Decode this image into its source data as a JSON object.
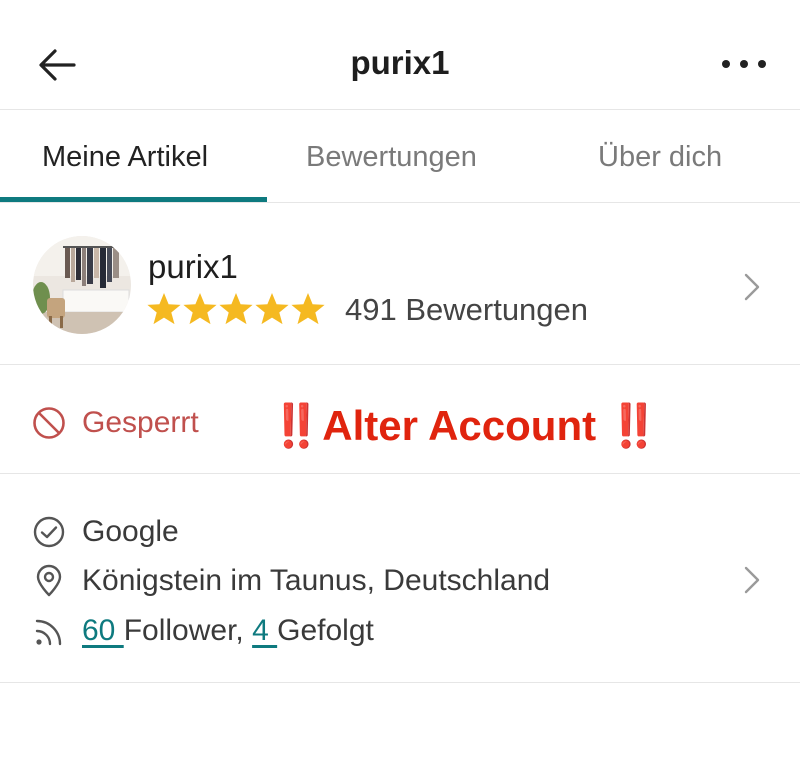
{
  "header": {
    "title": "purix1",
    "back_icon": "arrow-left-icon",
    "more_icon": "more-horizontal-icon"
  },
  "tabs": [
    {
      "label": "Meine Artikel",
      "active": true
    },
    {
      "label": "Bewertungen",
      "active": false
    },
    {
      "label": "Über dich",
      "active": false
    }
  ],
  "profile": {
    "name": "purix1",
    "rating": 5,
    "rating_max": 5,
    "reviews_label": "491 Bewertungen"
  },
  "status": {
    "label": "Gesperrt",
    "icon": "blocked-icon",
    "alert": "‼️Alter Account ‼️"
  },
  "info": {
    "verified_via": "Google",
    "location": "Königstein im Taunus, Deutschland",
    "followers_count": "60 ",
    "followers_label": "Follower, ",
    "following_count": "4 ",
    "following_label": "Gefolgt"
  },
  "colors": {
    "accent": "#0e7a7f",
    "star": "#f5b921",
    "blocked": "#c0504d",
    "alert": "#e0240e"
  }
}
